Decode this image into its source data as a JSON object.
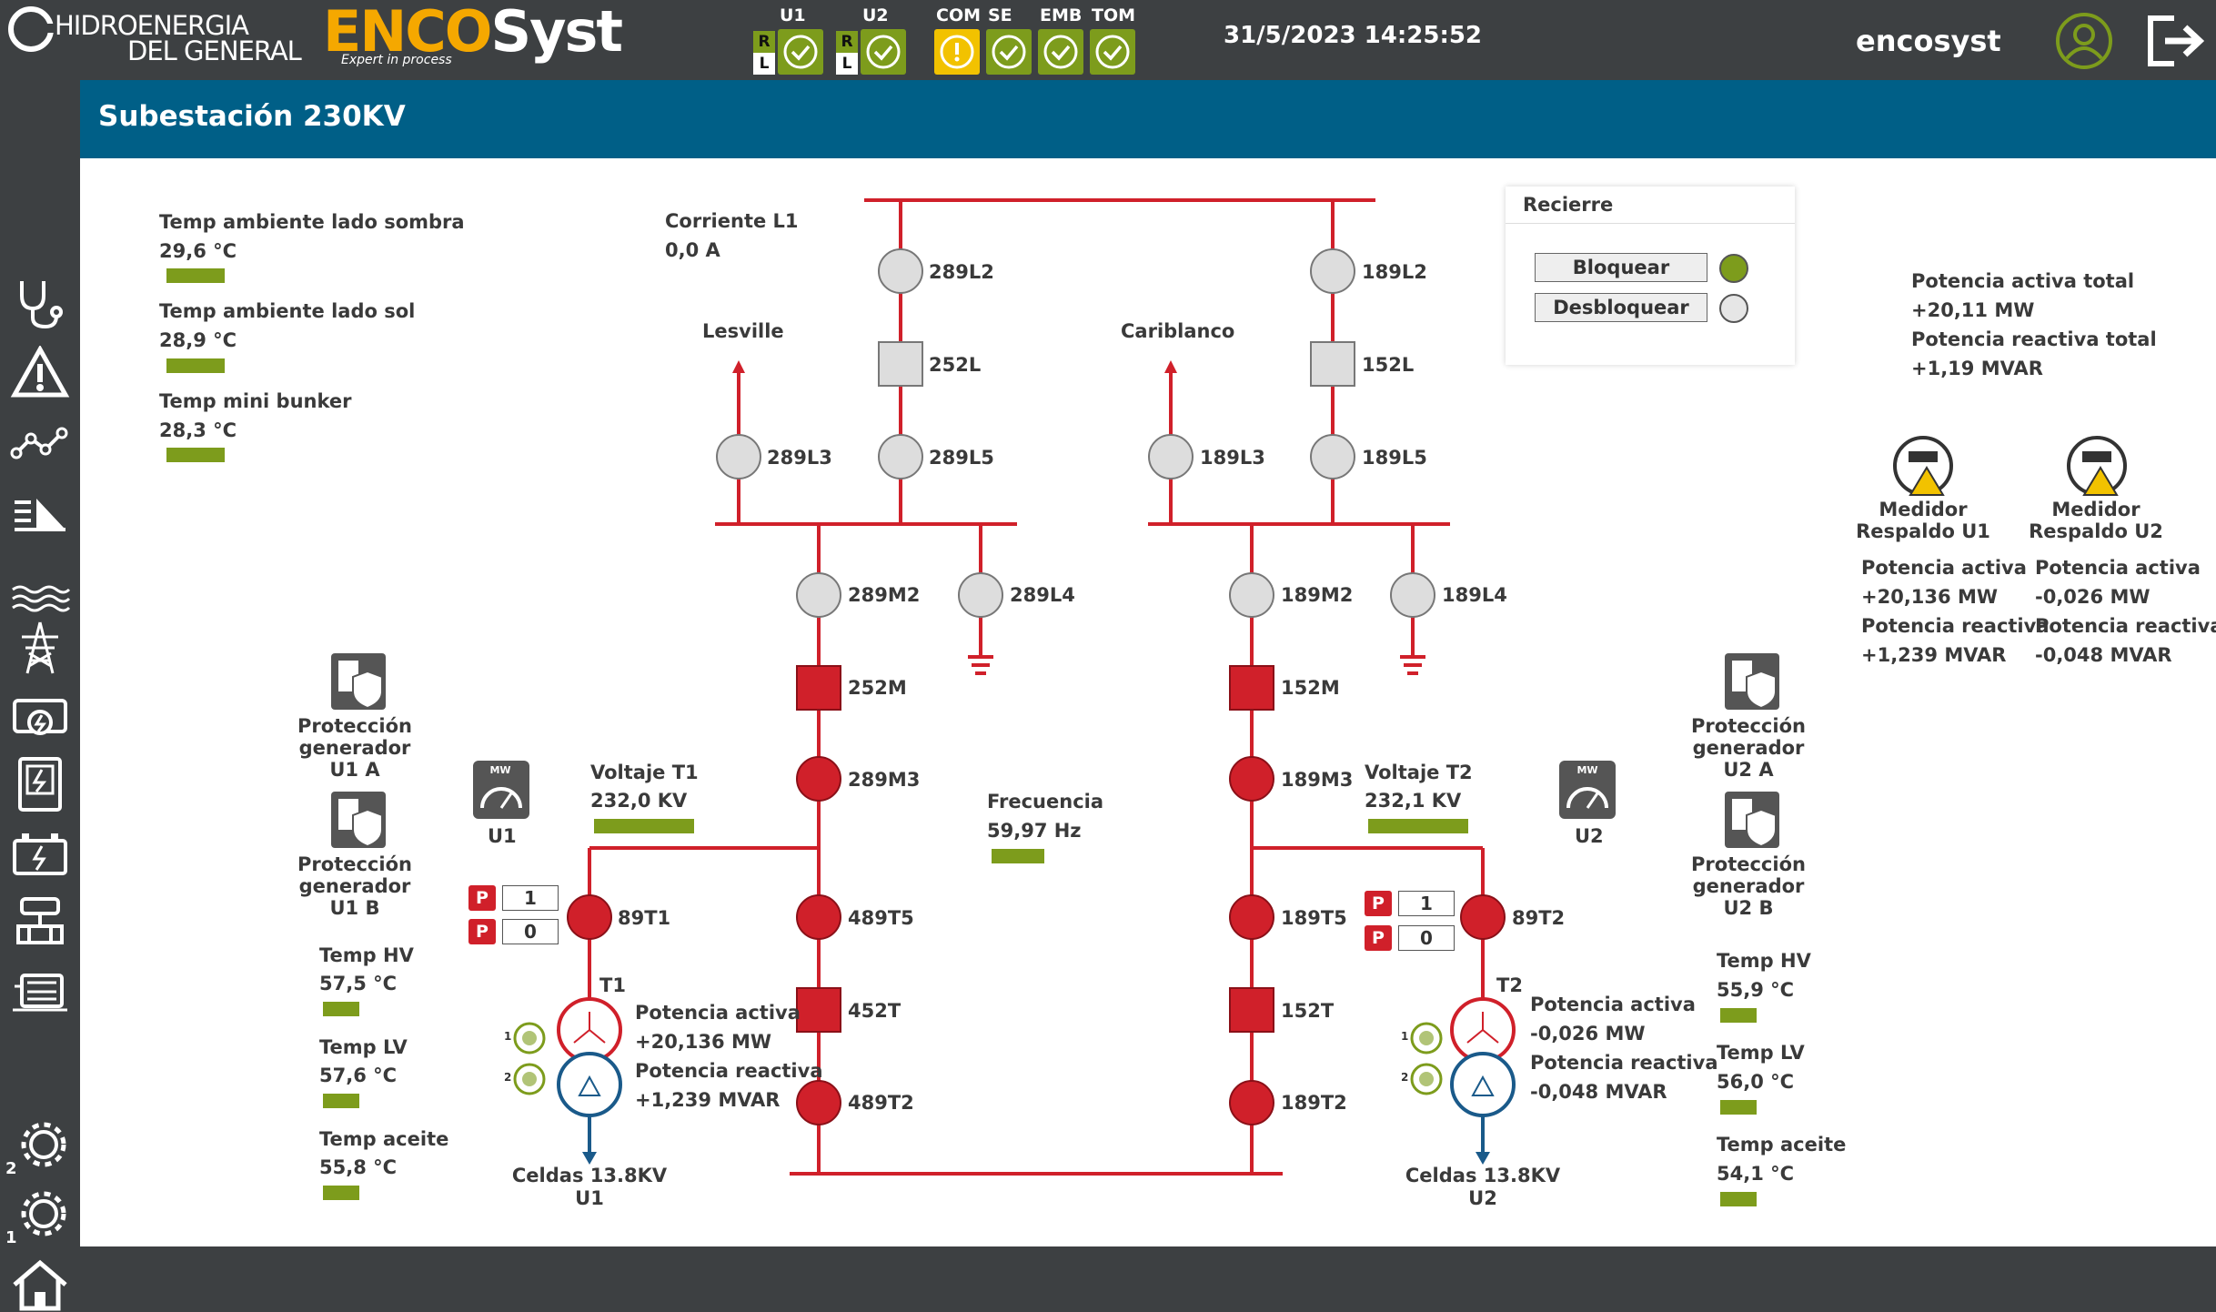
{
  "header": {
    "brand_left": [
      "HIDROENERGIA",
      "DEL GENERAL"
    ],
    "brand_enco": "ENCO",
    "brand_syst": "Syst",
    "brand_tagline": "Expert in process",
    "status": [
      {
        "label": "U1",
        "state": "ok",
        "rl": true
      },
      {
        "label": "U2",
        "state": "ok",
        "rl": true
      },
      {
        "label": "COM",
        "state": "warn",
        "rl": false
      },
      {
        "label": "SE",
        "state": "ok",
        "rl": false
      },
      {
        "label": "EMB",
        "state": "ok",
        "rl": false
      },
      {
        "label": "TOM",
        "state": "ok",
        "rl": false
      }
    ],
    "rl_r": "R",
    "rl_l": "L",
    "datetime": "31/5/2023 14:25:52",
    "username": "encosyst",
    "colors": {
      "ok": "#7d9c1c",
      "warn": "#f2c200",
      "accent": "#005f87",
      "breaker": "#d0202a",
      "line": "#d0202a"
    }
  },
  "page_title": "Subestación 230KV",
  "sidebar": [
    "stethoscope-icon",
    "alarm-icon",
    "trend-icon",
    "level-icon",
    "water-icon",
    "tower-icon",
    "generator-icon",
    "panel-icon",
    "battery-icon",
    "valve-icon",
    "turbine-icon",
    "gear-2-icon",
    "gear-1-icon",
    "home-icon"
  ],
  "sidebar_badges": {
    "gear2": "2",
    "gear1": "1"
  },
  "temps_top": [
    {
      "label": "Temp ambiente lado sombra",
      "value": "29,6 °C"
    },
    {
      "label": "Temp ambiente lado sol",
      "value": "28,9 °C"
    },
    {
      "label": "Temp mini bunker",
      "value": "28,3 °C"
    }
  ],
  "corriente": {
    "label": "Corriente L1",
    "value": "0,0 A"
  },
  "lines": {
    "left": "Lesville",
    "right": "Cariblanco"
  },
  "nodes": {
    "n289L2": "289L2",
    "n252L": "252L",
    "n289L3": "289L3",
    "n289L5": "289L5",
    "n189L2": "189L2",
    "n152L": "152L",
    "n189L3": "189L3",
    "n189L5": "189L5",
    "n289M2": "289M2",
    "n289L4": "289L4",
    "n189M2": "189M2",
    "n189L4": "189L4",
    "n252M": "252M",
    "n152M": "152M",
    "n289M3": "289M3",
    "n189M3": "189M3",
    "n89T1": "89T1",
    "n489T5": "489T5",
    "n189T5": "189T5",
    "n89T2": "89T2",
    "n452T": "452T",
    "n152T": "152T",
    "n489T2": "489T2",
    "n189T2": "189T2",
    "t1": "T1",
    "t2": "T2"
  },
  "recierre": {
    "title": "Recierre",
    "block": "Bloquear",
    "unblock": "Desbloquear",
    "block_state": "on",
    "unblock_state": "off"
  },
  "totals": {
    "p_label": "Potencia activa total",
    "p_value": "+20,11 MW",
    "q_label": "Potencia reactiva total",
    "q_value": "+1,19 MVAR"
  },
  "meters": [
    {
      "title": "Medidor\nRespaldo U1",
      "p_label": "Potencia activa",
      "p_value": "+20,136 MW",
      "q_label": "Potencia reactiva",
      "q_value": "+1,239 MVAR"
    },
    {
      "title": "Medidor\nRespaldo U2",
      "p_label": "Potencia activa",
      "p_value": "-0,026 MW",
      "q_label": "Potencia reactiva",
      "q_value": "-0,048 MVAR"
    }
  ],
  "protections": {
    "u1a": "Protección\ngenerador\nU1 A",
    "u1b": "Protección\ngenerador\nU1 B",
    "u2a": "Protección\ngenerador\nU2 A",
    "u2b": "Protección\ngenerador\nU2 B"
  },
  "mw_gauges": {
    "u1": "U1",
    "u2": "U2",
    "mw": "MW"
  },
  "voltaje": {
    "t1_label": "Voltaje T1",
    "t1_value": "232,0 KV",
    "t2_label": "Voltaje T2",
    "t2_value": "232,1 KV"
  },
  "frecuencia": {
    "label": "Frecuencia",
    "value": "59,97 Hz"
  },
  "pcounters": {
    "badge": "P",
    "t1": [
      "1",
      "0"
    ],
    "t2": [
      "1",
      "0"
    ]
  },
  "t1_power": {
    "p_label": "Potencia activa",
    "p_value": "+20,136 MW",
    "q_label": "Potencia reactiva",
    "q_value": "+1,239 MVAR"
  },
  "t2_power": {
    "p_label": "Potencia activa",
    "p_value": "-0,026 MW",
    "q_label": "Potencia reactiva",
    "q_value": "-0,048 MVAR"
  },
  "celdas": {
    "u1": "Celdas 13.8KV\nU1",
    "u2": "Celdas 13.8KV\nU2"
  },
  "fans": {
    "n1": "1",
    "n2": "2"
  },
  "temps_u1": [
    {
      "label": "Temp HV",
      "value": "57,5 °C"
    },
    {
      "label": "Temp LV",
      "value": "57,6 °C"
    },
    {
      "label": "Temp aceite",
      "value": "55,8 °C"
    }
  ],
  "temps_u2": [
    {
      "label": "Temp HV",
      "value": "55,9 °C"
    },
    {
      "label": "Temp LV",
      "value": "56,0 °C"
    },
    {
      "label": "Temp aceite",
      "value": "54,1 °C"
    }
  ]
}
